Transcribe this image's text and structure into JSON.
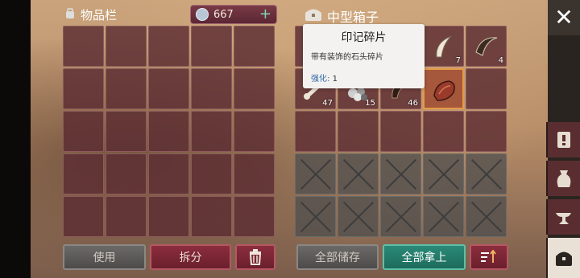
{
  "inventory": {
    "title": "物品栏",
    "currency": "667"
  },
  "chest": {
    "title": "中型箱子"
  },
  "tooltip": {
    "title": "印记碎片",
    "description": "带有装饰的石头碎片",
    "upgrade_label": "强化:",
    "upgrade_value": "1"
  },
  "chest_items": {
    "r0c3": {
      "icon": "claw-icon",
      "qty": "7"
    },
    "r0c4": {
      "icon": "fang-icon",
      "qty": "4"
    },
    "r1c0": {
      "icon": "bone-icon",
      "qty": "47"
    },
    "r1c1": {
      "icon": "stones-icon",
      "qty": "15"
    },
    "r1c2": {
      "icon": "horn-icon",
      "qty": "46"
    },
    "r1c3": {
      "icon": "leather-icon",
      "qty": ""
    }
  },
  "buttons": {
    "use": "使用",
    "split": "拆分",
    "store_all": "全部储存",
    "take_all": "全部拿上"
  },
  "colors": {
    "accent_teal": "#2a8a78",
    "slot": "#5c2c32",
    "highlight": "#e49a46"
  }
}
